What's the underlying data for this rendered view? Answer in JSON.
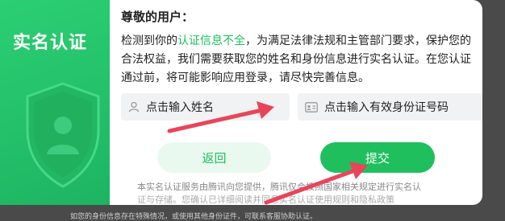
{
  "side": {
    "title": "实名认证"
  },
  "greeting": "尊敬的用户：",
  "body": {
    "part1": "检测到你的",
    "highlight": "认证信息不全",
    "part2": "，为满足法律法规和主管部门要求，保护您的合法权益，我们需要获取您的姓名和身份信息进行实名认证。在您认证通过前，将可能影响应用登录，请尽快完善信息。"
  },
  "inputs": {
    "name_placeholder": "点击输入姓名",
    "id_placeholder": "点击输入有效身份证号码"
  },
  "buttons": {
    "back": "返回",
    "submit": "提交"
  },
  "notice": {
    "line1": "本实名认证服务由腾讯向您提供，腾讯仅会按照国家相关规定进行实名认",
    "line2": "证与存储。您确认已详细阅读并同意实名认证使用规则和隐私政策"
  },
  "hint": "如您的身份信息存在特殊情况，或使用其他身份证件，可联系客服协助认证。",
  "colors": {
    "accent": "#1fbf5e",
    "arrow": "#e8455a"
  },
  "icons": [
    "shield-person-icon",
    "person-icon",
    "id-card-icon",
    "check-circle-icon"
  ]
}
